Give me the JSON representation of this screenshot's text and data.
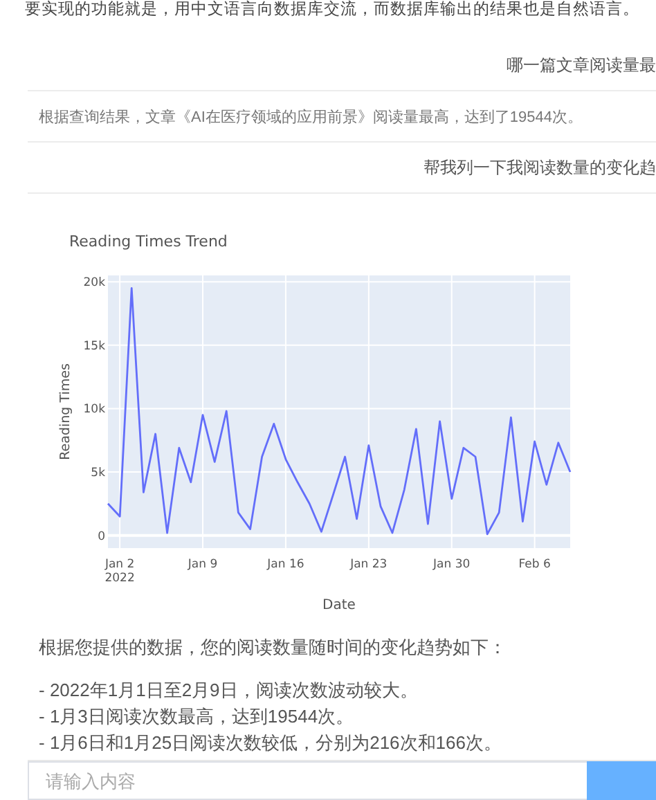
{
  "intro": "要实现的功能就是，用中文语言向数据库交流，而数据库输出的结果也是自然语言。",
  "messages": [
    {
      "kind": "question",
      "text": "哪一篇文章阅读量最"
    },
    {
      "kind": "answer",
      "text": "根据查询结果，文章《AI在医疗领域的应用前景》阅读量最高，达到了19544次。"
    },
    {
      "kind": "question",
      "text": "帮我列一下我阅读数量的变化趋"
    }
  ],
  "chart": {
    "chart_data": {
      "type": "line",
      "grid": true,
      "title": "Reading Times Trend",
      "xlabel": "Date",
      "ylabel": "Reading Times",
      "x": [
        "2022-01-01",
        "2022-01-02",
        "2022-01-03",
        "2022-01-04",
        "2022-01-05",
        "2022-01-06",
        "2022-01-07",
        "2022-01-08",
        "2022-01-09",
        "2022-01-10",
        "2022-01-11",
        "2022-01-12",
        "2022-01-13",
        "2022-01-14",
        "2022-01-15",
        "2022-01-16",
        "2022-01-17",
        "2022-01-18",
        "2022-01-19",
        "2022-01-20",
        "2022-01-21",
        "2022-01-22",
        "2022-01-23",
        "2022-01-24",
        "2022-01-25",
        "2022-01-26",
        "2022-01-27",
        "2022-01-28",
        "2022-01-29",
        "2022-01-30",
        "2022-01-31",
        "2022-02-01",
        "2022-02-02",
        "2022-02-03",
        "2022-02-04",
        "2022-02-05",
        "2022-02-06",
        "2022-02-07",
        "2022-02-08",
        "2022-02-09"
      ],
      "series": [
        {
          "color": "#636efa",
          "values": [
            2500,
            1500,
            19500,
            3400,
            8000,
            200,
            6900,
            4200,
            9500,
            5800,
            9800,
            1800,
            500,
            6200,
            8800,
            6000,
            4200,
            2500,
            300,
            3200,
            6200,
            1300,
            7100,
            2300,
            200,
            3600,
            8400,
            900,
            9000,
            2900,
            6900,
            6200,
            100,
            1800,
            9300,
            1100,
            7400,
            4000,
            7300,
            5000
          ]
        }
      ],
      "xlim": [
        "2022-01-01",
        "2022-02-09"
      ],
      "ylim": [
        -1000,
        20500
      ],
      "xticks": [
        {
          "value": "2022-01-02",
          "label": "Jan 2\n2022"
        },
        {
          "value": "2022-01-09",
          "label": "Jan 9"
        },
        {
          "value": "2022-01-16",
          "label": "Jan 16"
        },
        {
          "value": "2022-01-23",
          "label": "Jan 23"
        },
        {
          "value": "2022-01-30",
          "label": "Jan 30"
        },
        {
          "value": "2022-02-06",
          "label": "Feb 6"
        }
      ],
      "yticks": [
        {
          "value": 0,
          "label": "0"
        },
        {
          "value": 5000,
          "label": "5k"
        },
        {
          "value": 10000,
          "label": "10k"
        },
        {
          "value": 15000,
          "label": "15k"
        },
        {
          "value": 20000,
          "label": "20k"
        }
      ]
    }
  },
  "summary": "根据您提供的数据，您的阅读数量随时间的变化趋势如下：",
  "bullets": [
    "- 2022年1月1日至2月9日，阅读次数波动较大。",
    "- 1月3日阅读次数最高，达到19544次。",
    "- 1月6日和1月25日阅读次数较低，分别为216次和166次。"
  ],
  "input": {
    "placeholder": "请输入内容"
  }
}
